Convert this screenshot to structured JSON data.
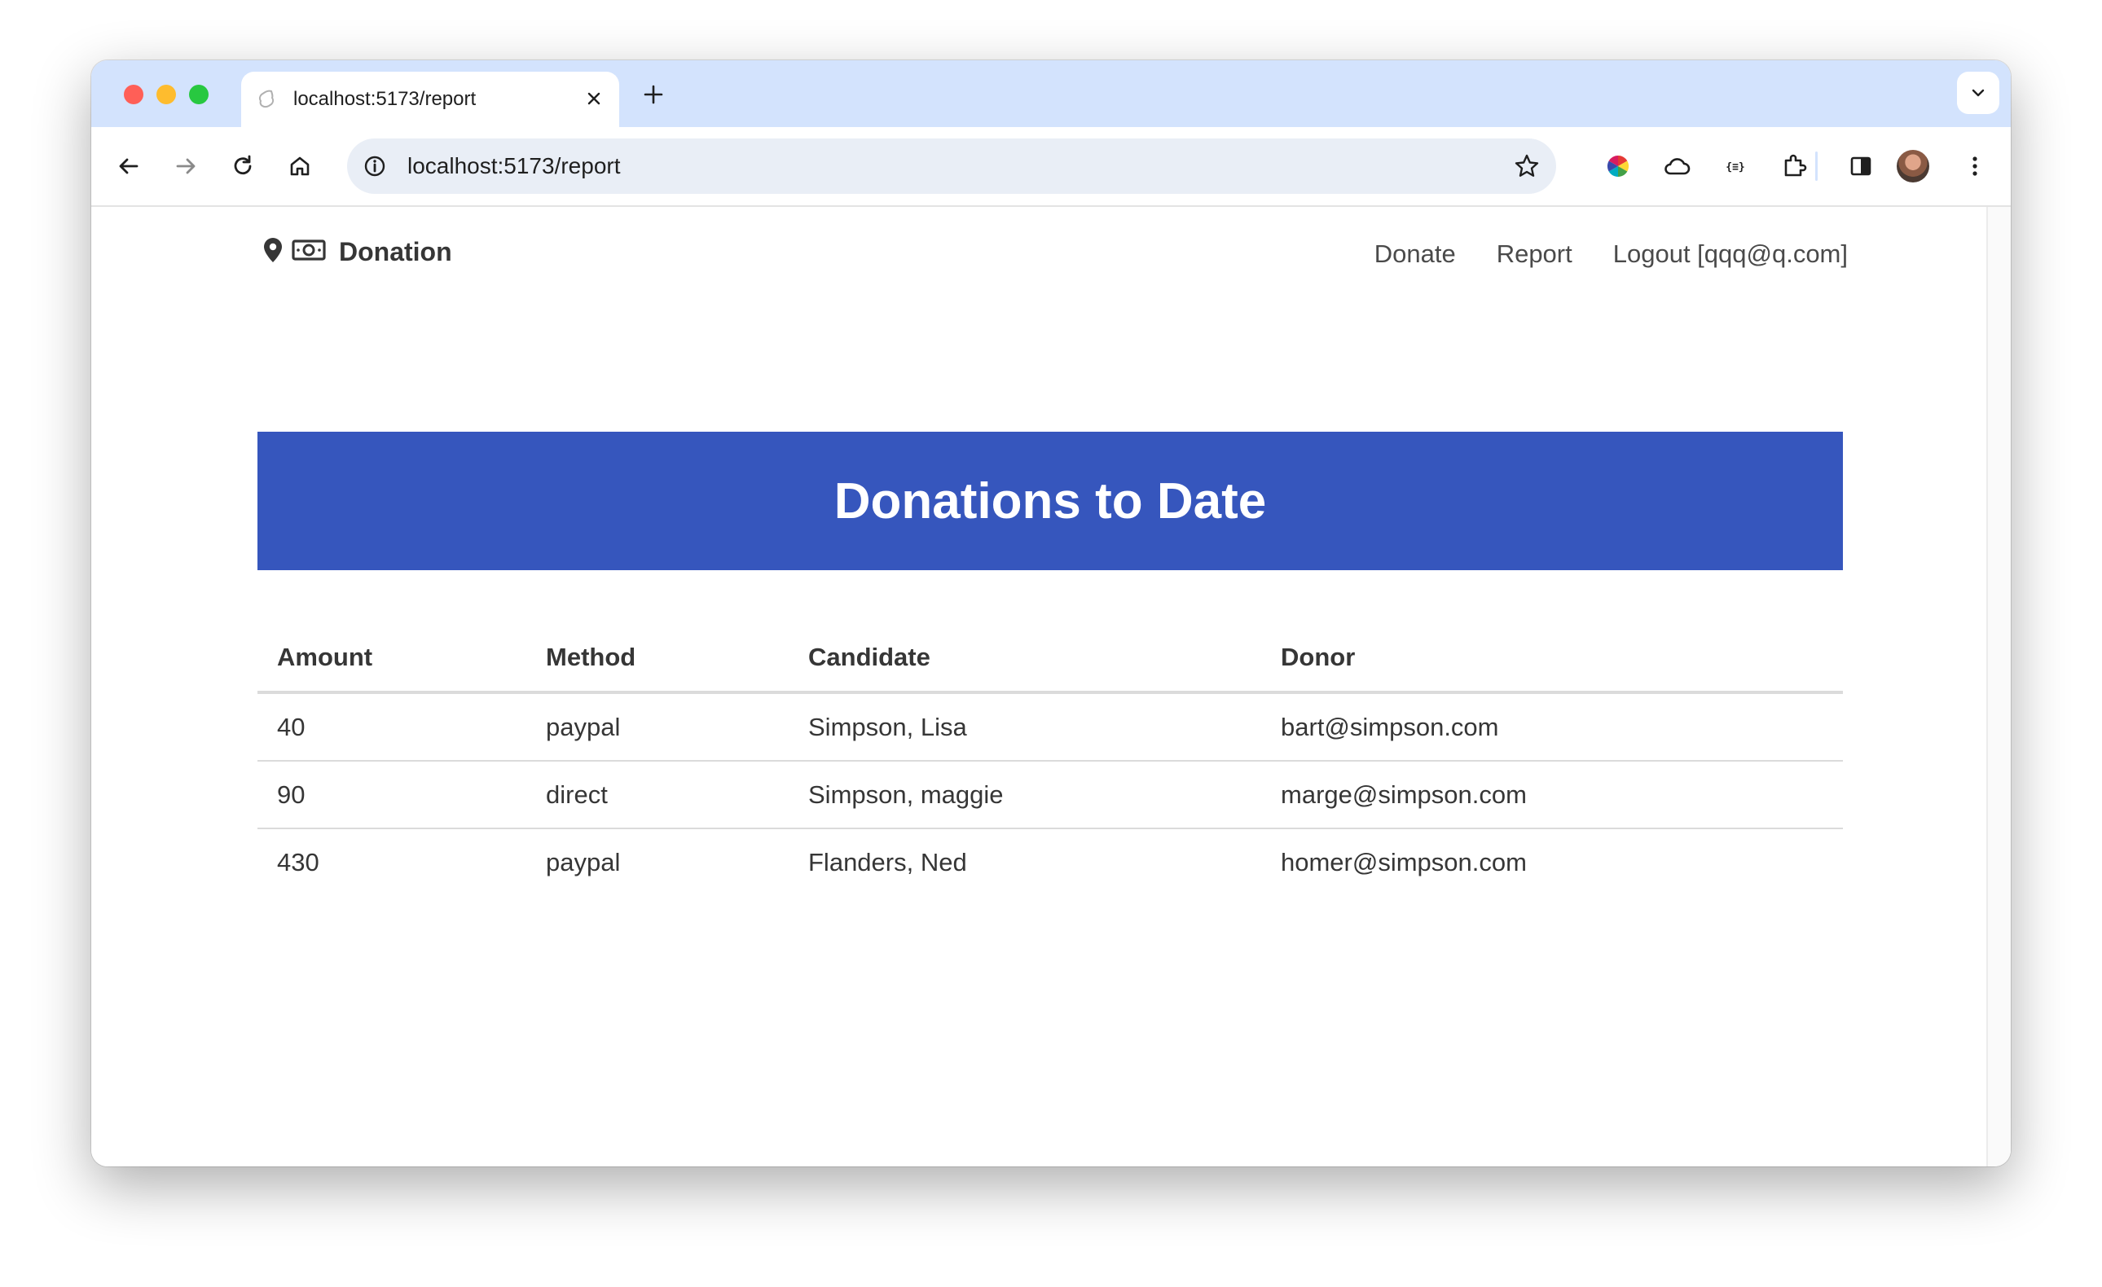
{
  "browser": {
    "tab_title": "localhost:5173/report",
    "url": "localhost:5173/report",
    "icons": [
      "back-icon",
      "forward-icon",
      "reload-icon",
      "home-icon",
      "info-icon",
      "star-icon",
      "color-wheel-extension-icon",
      "cloud-icon",
      "json-formatter-icon",
      "extensions-puzzle-icon",
      "side-panel-icon",
      "more-vert-icon"
    ]
  },
  "navbar": {
    "brand": "Donation",
    "links": [
      "Donate",
      "Report",
      "Logout [qqq@q.com]"
    ]
  },
  "hero": {
    "title": "Donations to Date",
    "color": "#3656bd"
  },
  "table": {
    "columns": [
      "Amount",
      "Method",
      "Candidate",
      "Donor"
    ],
    "rows": [
      [
        "40",
        "paypal",
        "Simpson, Lisa",
        "bart@simpson.com"
      ],
      [
        "90",
        "direct",
        "Simpson, maggie",
        "marge@simpson.com"
      ],
      [
        "430",
        "paypal",
        "Flanders, Ned",
        "homer@simpson.com"
      ]
    ]
  }
}
